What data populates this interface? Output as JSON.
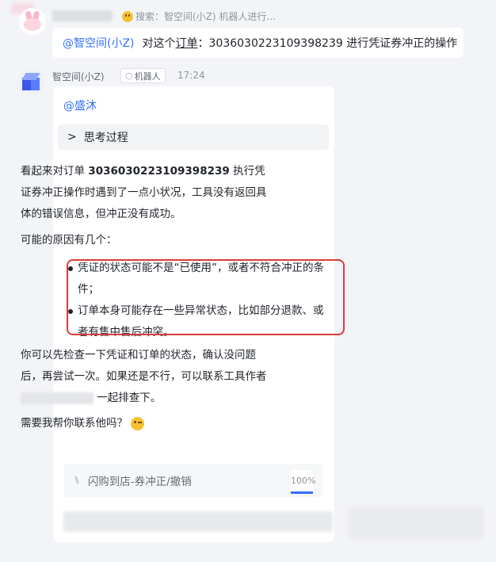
{
  "user_message": {
    "search_prefix": "搜索：智空间(小Z) 机器人进行...",
    "mention": "@智空间(小Z)",
    "text_before": "对这个",
    "text_underlined": "订单",
    "text_after": "：3036030223109398239 进行凭证券冲正的操作"
  },
  "bot": {
    "name": "智空间(小Z)",
    "tag": "机器人",
    "time": "17:24",
    "mention": "@盛沐",
    "think_label": "思考过程",
    "para1_prefix": "看起来对订单 ",
    "order_no": "3036030223109398239",
    "para1_suffix": " 执行凭证券冲正操作时遇到了一点小状况，工具没有返回具体的错误信息，但冲正没有成功。",
    "para2": "可能的原因有几个：",
    "bullets": [
      "凭证的状态可能不是“已使用”，或者不符合冲正的条件；",
      "订单本身可能存在一些异常状态，比如部分退款、或者有售中售后冲突。"
    ],
    "para3_prefix": "你可以先检查一下凭证和订单的状态，确认没问题后，再尝试一次。如果还是不行，可以联系工具作者",
    "para3_suffix": "一起排查下。",
    "para4": "需要我帮你联系他吗？",
    "product_label": "闪购到店-券冲正/撤销",
    "progress": "100%"
  },
  "colors": {
    "accent": "#3370ff",
    "highlight_box": "#d83c3c"
  },
  "icons": [
    "rabbit-avatar-icon",
    "emoji-face-icon",
    "cube-bot-avatar-icon",
    "robot-icon",
    "chevron-right-icon",
    "tool-icon",
    "wink-emoji-icon"
  ]
}
